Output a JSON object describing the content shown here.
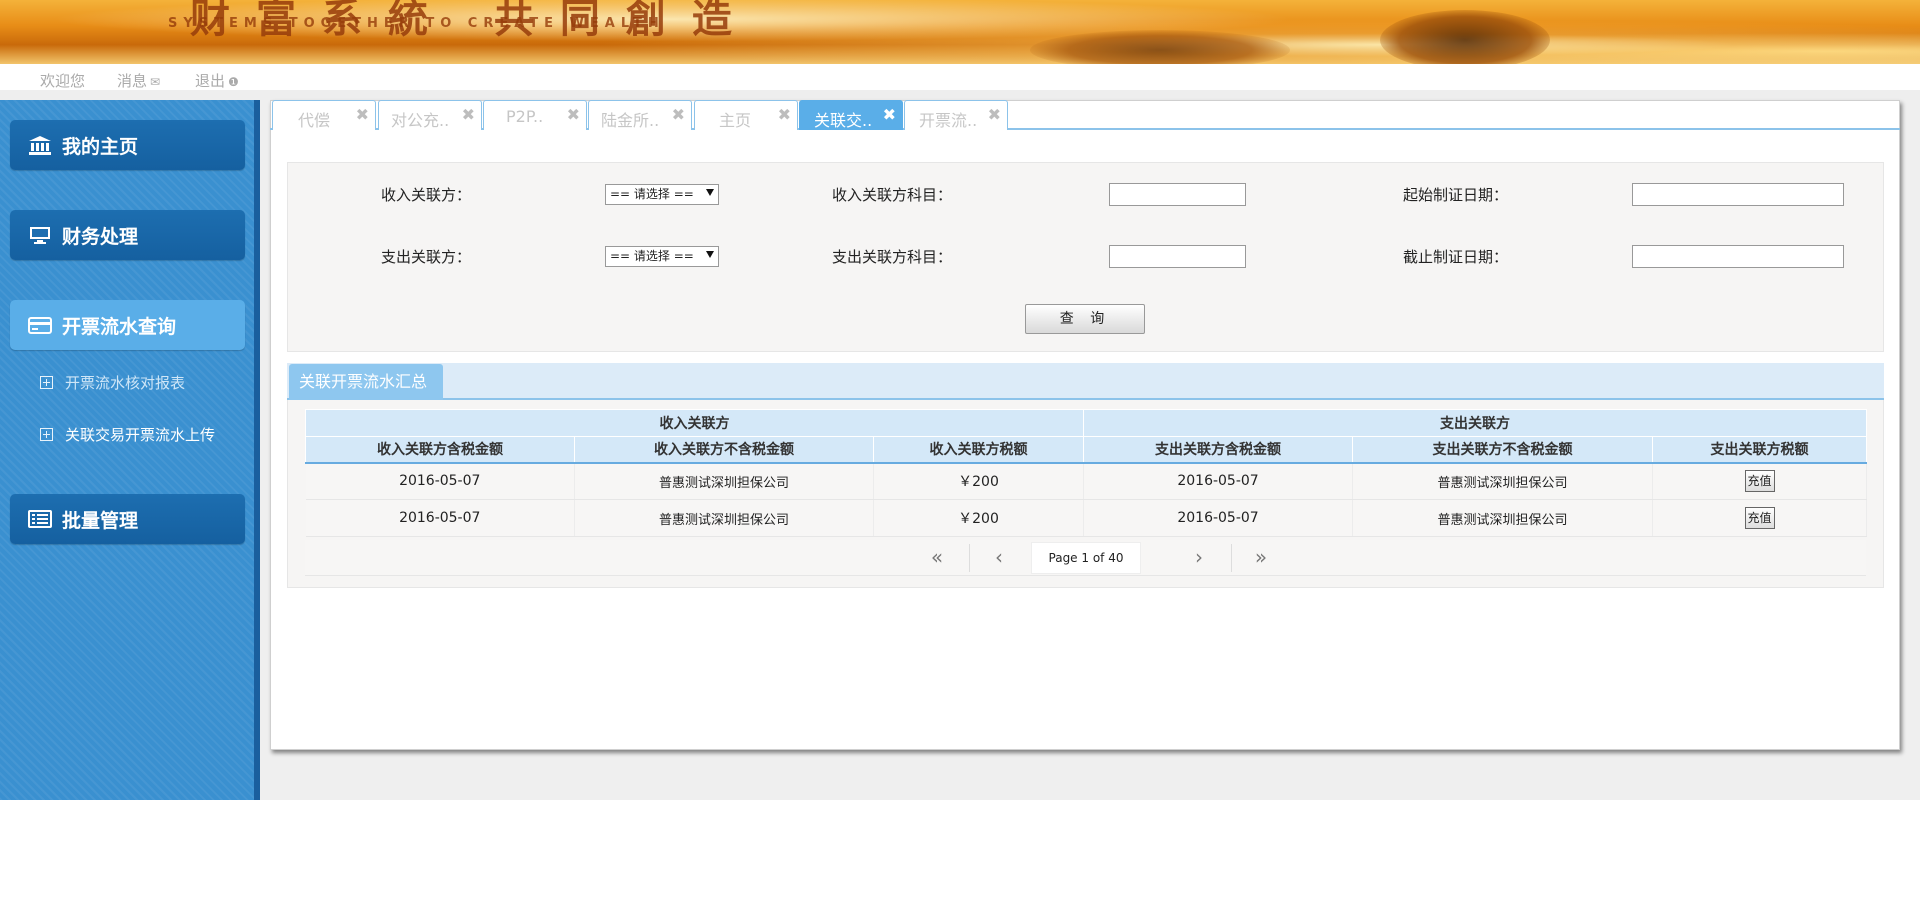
{
  "banner": {
    "title": "财富系統 共同創造",
    "subtitle": "SYSTEMS TOGETHER TO CREATE WEALTH"
  },
  "topnav": {
    "welcome": "欢迎您",
    "messages": "消息",
    "logout": "退出"
  },
  "tabs": [
    {
      "label": "代偿"
    },
    {
      "label": "对公充.."
    },
    {
      "label": "P2P.."
    },
    {
      "label": "陆金所.."
    },
    {
      "label": "主页"
    },
    {
      "label": "关联交.."
    },
    {
      "label": "开票流.."
    }
  ],
  "sidebar": {
    "menus": [
      {
        "label": "我的主页"
      },
      {
        "label": "财务处理"
      },
      {
        "label": "开票流水查询"
      },
      {
        "label": "批量管理"
      }
    ],
    "subitems": [
      {
        "label": "开票流水核对报表"
      },
      {
        "label": "关联交易开票流水上传"
      }
    ]
  },
  "form": {
    "income_party_label": "收入关联方：",
    "income_party_select": "== 请选择 ==",
    "income_subject_label": "收入关联方科目：",
    "start_date_label": "起始制证日期：",
    "expense_party_label": "支出关联方：",
    "expense_party_select": "== 请选择 ==",
    "expense_subject_label": "支出关联方科目：",
    "end_date_label": "截止制证日期：",
    "query_button": "查 询"
  },
  "summary": {
    "tab_label": "关联开票流水汇总",
    "group_headers": [
      "收入关联方",
      "支出关联方"
    ],
    "columns": [
      "收入关联方含税金额",
      "收入关联方不含税金额",
      "收入关联方税额",
      "支出关联方含税金额",
      "支出关联方不含税金额",
      "支出关联方税额"
    ],
    "rows": [
      [
        "2016-05-07",
        "普惠测试深圳担保公司",
        "￥200",
        "2016-05-07",
        "普惠测试深圳担保公司",
        "充值"
      ],
      [
        "2016-05-07",
        "普惠测试深圳担保公司",
        "￥200",
        "2016-05-07",
        "普惠测试深圳担保公司",
        "充值"
      ]
    ],
    "pager": {
      "info": "Page 1 of 40"
    }
  },
  "colors": {
    "sidebar_bg": "#3a90d0",
    "menu_bg": "#1d6eb0",
    "accent": "#5aaee8",
    "header_bg": "#d4e8f8"
  }
}
